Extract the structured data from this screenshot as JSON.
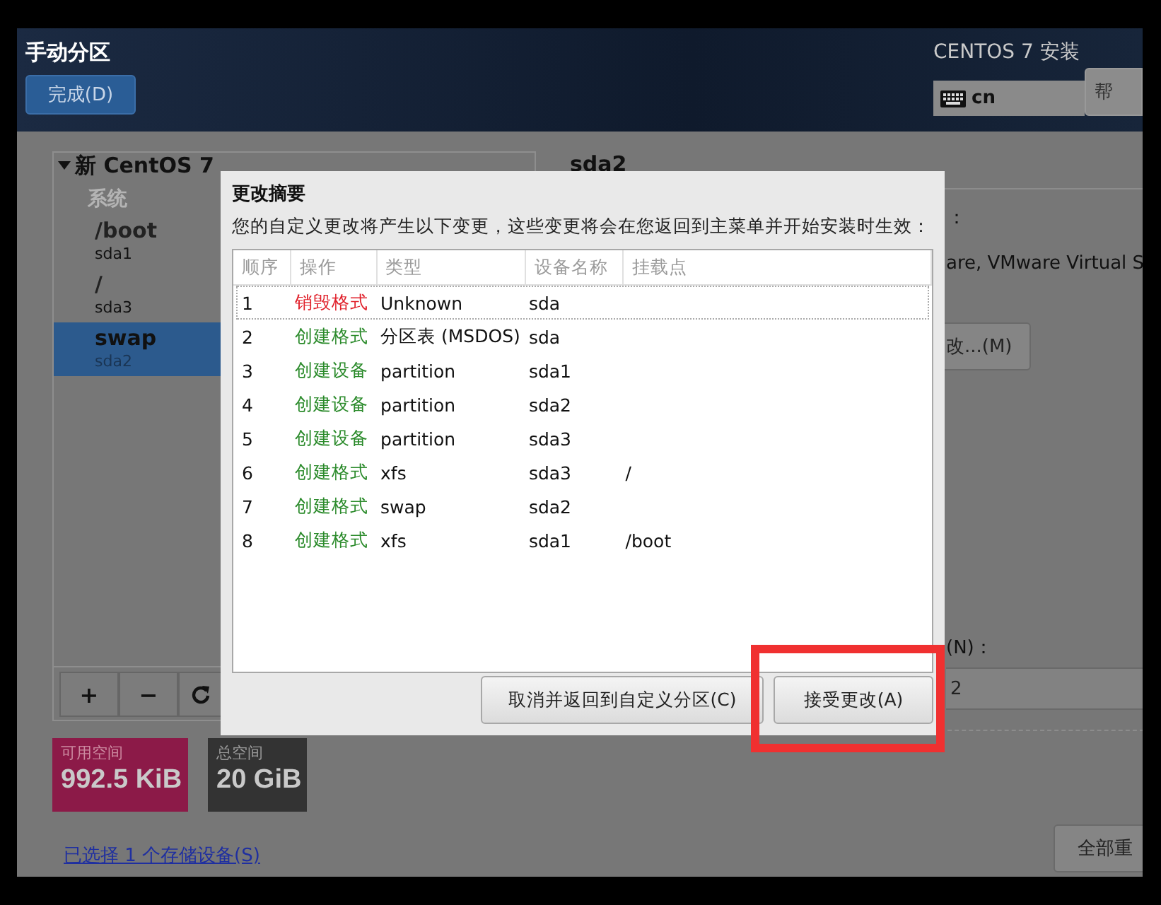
{
  "header": {
    "title": "手动分区",
    "done_button": "完成(D)",
    "product": "CENTOS 7 安装",
    "keyboard_layout": "cn",
    "help_button": "帮"
  },
  "tree": {
    "root": "新 CentOS 7",
    "expanded": true,
    "group": "系统",
    "items": [
      {
        "mount": "/boot",
        "device": "sda1",
        "selected": false
      },
      {
        "mount": "/",
        "device": "sda3",
        "selected": false
      },
      {
        "mount": "swap",
        "device": "sda2",
        "selected": true
      }
    ]
  },
  "toolbar": [
    "+",
    "−"
  ],
  "space": [
    {
      "label": "可用空间",
      "value": "992.5 KiB",
      "color": "#8c1a48"
    },
    {
      "label": "总空间",
      "value": "20 GiB",
      "color": "#333333"
    }
  ],
  "storage_link": "已选择 1 个存储设备(S)",
  "detail": {
    "device": "sda2",
    "label_fragment": "：",
    "device_fragment": "are, VMware Virtual S",
    "modify_button": "改...(M)",
    "name_label_fragment": "(N)：",
    "name_value_fragment": "2",
    "reset_button": "全部重"
  },
  "dialog": {
    "title": "更改摘要",
    "message": "您的自定义更改将产生以下变更，这些变更将会在您返回到主菜单并开始安装时生效：",
    "columns": [
      "顺序",
      "操作",
      "类型",
      "设备名称",
      "挂载点"
    ],
    "rows": [
      {
        "order": "1",
        "action": "销毁格式",
        "color": "#e0202a",
        "type": "Unknown",
        "device": "sda",
        "selected": true
      },
      {
        "order": "2",
        "action": "创建格式",
        "color": "#2a8a2a",
        "type": "分区表 (MSDOS)",
        "device": "sda",
        "selected": false
      },
      {
        "order": "3",
        "action": "创建设备",
        "color": "#2a8a2a",
        "type": "partition",
        "device": "sda1",
        "selected": false
      },
      {
        "order": "4",
        "action": "创建设备",
        "color": "#2a8a2a",
        "type": "partition",
        "device": "sda2",
        "selected": false
      },
      {
        "order": "5",
        "action": "创建设备",
        "color": "#2a8a2a",
        "type": "partition",
        "device": "sda3",
        "selected": false
      },
      {
        "order": "6",
        "action": "创建格式",
        "color": "#2a8a2a",
        "type": "xfs",
        "device": "sda3",
        "mount": "/",
        "selected": false
      },
      {
        "order": "7",
        "action": "创建格式",
        "color": "#2a8a2a",
        "type": "swap",
        "device": "sda2",
        "selected": false
      },
      {
        "order": "8",
        "action": "创建格式",
        "color": "#2a8a2a",
        "type": "xfs",
        "device": "sda1",
        "mount": "/boot",
        "selected": false
      }
    ],
    "cancel_button": "取消并返回到自定义分区(C)",
    "accept_button": "接受更改(A)"
  }
}
